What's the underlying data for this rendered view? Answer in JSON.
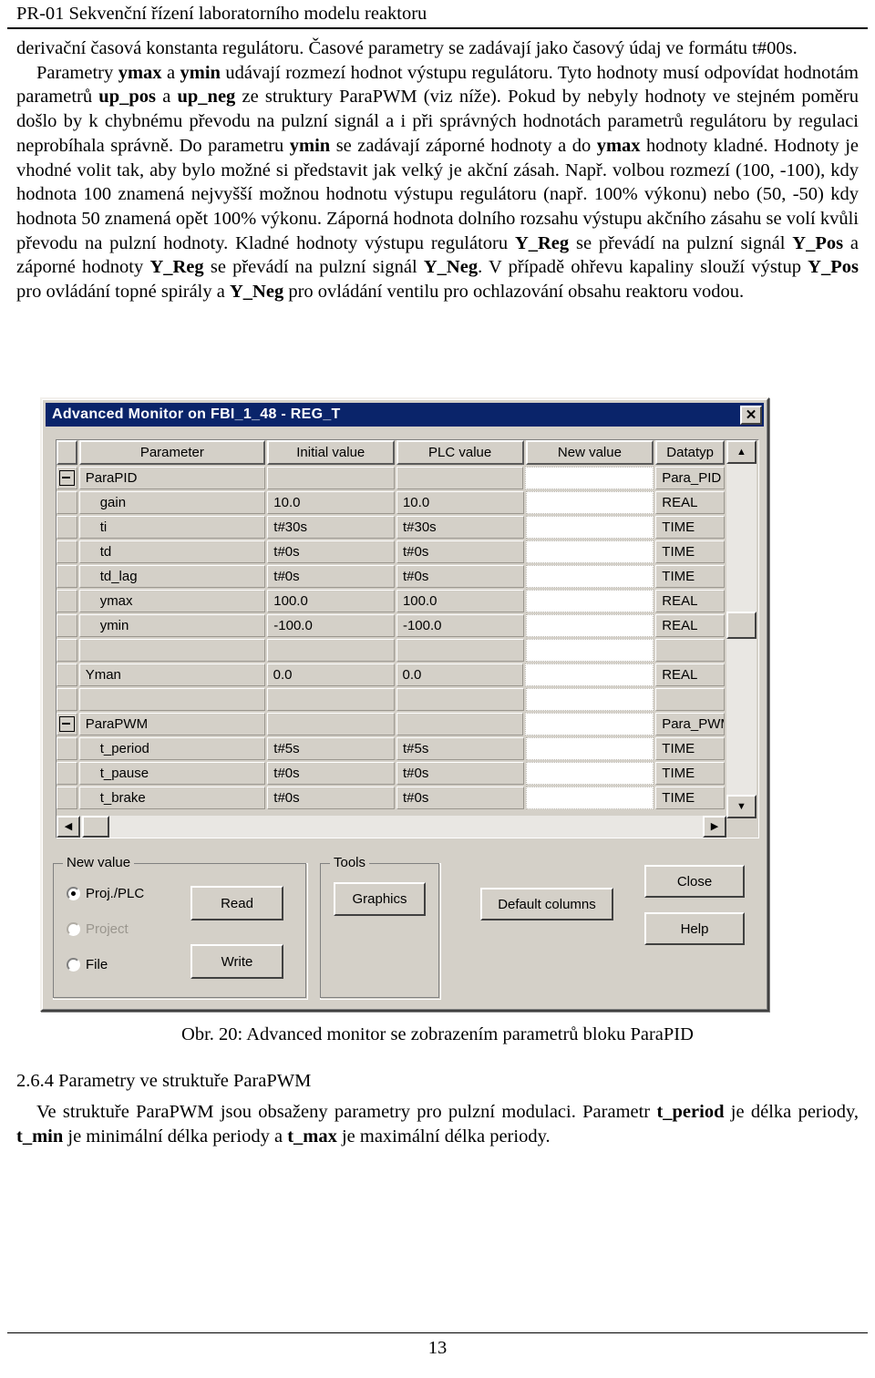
{
  "header": {
    "title": "PR-01 Sekvenční řízení laboratorního modelu reaktoru"
  },
  "body": {
    "para1_a": "derivační časová konstanta regulátoru. Časové parametry se zadávají jako časový údaj ve formátu t#00s.",
    "para2_seg1": "Parametry ",
    "para2_b1": "ymax",
    "para2_seg2": " a ",
    "para2_b2": "ymin",
    "para2_seg3": " udávají rozmezí hodnot výstupu regulátoru. Tyto hodnoty musí odpovídat hodnotám parametrů ",
    "para2_b3": "up_pos",
    "para2_seg4": " a ",
    "para2_b4": "up_neg",
    "para2_seg5": " ze struktury ParaPWM (viz níže). Pokud by nebyly hodnoty ve stejném poměru došlo by k chybnému převodu na pulzní signál a i při správných hodnotách parametrů regulátoru by regulaci neprobíhala správně. Do parametru ",
    "para2_b5": "ymin",
    "para2_seg6": " se zadávají záporné hodnoty a do ",
    "para2_b6": "ymax",
    "para2_seg7": " hodnoty kladné. Hodnoty je vhodné volit tak, aby bylo možné si představit jak velký je akční zásah. Např. volbou rozmezí (100, -100), kdy hodnota 100 znamená nejvyšší možnou hodnotu výstupu regulátoru (např. 100% výkonu) nebo (50, -50) kdy hodnota 50 znamená opět 100% výkonu. Záporná hodnota dolního rozsahu výstupu akčního zásahu se volí kvůli převodu na pulzní hodnoty. Kladné hodnoty výstupu regulátoru ",
    "para2_b7": "Y_Reg",
    "para2_seg8": " se převádí na pulzní signál ",
    "para2_b8": "Y_Pos",
    "para2_seg9": " a záporné hodnoty ",
    "para2_b9": "Y_Reg",
    "para2_seg10": " se převádí na pulzní signál ",
    "para2_b10": "Y_Neg",
    "para2_seg11": ". V případě ohřevu kapaliny slouží výstup ",
    "para2_b11": "Y_Pos",
    "para2_seg12": " pro ovládání topné spirály a ",
    "para2_b12": "Y_Neg",
    "para2_seg13": " pro ovládání ventilu pro ochlazování obsahu reaktoru vodou."
  },
  "dialog": {
    "title": "Advanced Monitor on FBI_1_48  -  REG_T",
    "close_glyph": "✕",
    "columns": [
      "",
      "Parameter",
      "Initial value",
      "PLC value",
      "New value",
      "Datatyp"
    ],
    "rows": [
      {
        "tree": "minus",
        "param": "ParaPID",
        "initial": "",
        "plc": "",
        "new": "",
        "type": "Para_PID",
        "indent": false
      },
      {
        "tree": "",
        "param": "gain",
        "initial": "10.0",
        "plc": "10.0",
        "new": "",
        "type": "REAL",
        "indent": true
      },
      {
        "tree": "",
        "param": "ti",
        "initial": "t#30s",
        "plc": "t#30s",
        "new": "",
        "type": "TIME",
        "indent": true
      },
      {
        "tree": "",
        "param": "td",
        "initial": "t#0s",
        "plc": "t#0s",
        "new": "",
        "type": "TIME",
        "indent": true
      },
      {
        "tree": "",
        "param": "td_lag",
        "initial": "t#0s",
        "plc": "t#0s",
        "new": "",
        "type": "TIME",
        "indent": true
      },
      {
        "tree": "",
        "param": "ymax",
        "initial": "100.0",
        "plc": "100.0",
        "new": "",
        "type": "REAL",
        "indent": true
      },
      {
        "tree": "",
        "param": "ymin",
        "initial": "-100.0",
        "plc": "-100.0",
        "new": "",
        "type": "REAL",
        "indent": true
      },
      {
        "tree": "",
        "param": "",
        "initial": "",
        "plc": "",
        "new": "",
        "type": "",
        "indent": true
      },
      {
        "tree": "",
        "param": "Yman",
        "initial": "0.0",
        "plc": "0.0",
        "new": "",
        "type": "REAL",
        "indent": false
      },
      {
        "tree": "",
        "param": "",
        "initial": "",
        "plc": "",
        "new": "",
        "type": "",
        "indent": true
      },
      {
        "tree": "minus",
        "param": "ParaPWM",
        "initial": "",
        "plc": "",
        "new": "",
        "type": "Para_PWM",
        "indent": false
      },
      {
        "tree": "",
        "param": "t_period",
        "initial": "t#5s",
        "plc": "t#5s",
        "new": "",
        "type": "TIME",
        "indent": true
      },
      {
        "tree": "",
        "param": "t_pause",
        "initial": "t#0s",
        "plc": "t#0s",
        "new": "",
        "type": "TIME",
        "indent": true
      },
      {
        "tree": "",
        "param": "t_brake",
        "initial": "t#0s",
        "plc": "t#0s",
        "new": "",
        "type": "TIME",
        "indent": true
      }
    ],
    "scrollbar": {
      "up_glyph": "▲",
      "down_glyph": "▼",
      "left_glyph": "◀",
      "right_glyph": "▶"
    },
    "new_value_group": {
      "title": "New value",
      "options": [
        {
          "label": "Proj./PLC",
          "checked": true,
          "disabled": false
        },
        {
          "label": "Project",
          "checked": false,
          "disabled": true
        },
        {
          "label": "File",
          "checked": false,
          "disabled": false
        }
      ],
      "read_label": "Read",
      "write_label": "Write"
    },
    "tools_group": {
      "title": "Tools",
      "graphics_label": "Graphics"
    },
    "default_columns_label": "Default columns",
    "close_label": "Close",
    "help_label": "Help"
  },
  "caption": "Obr. 20: Advanced monitor se zobrazením parametrů bloku ParaPID",
  "section": {
    "heading": "2.6.4 Parametry ve struktuře ParaPWM",
    "text_seg1": "Ve struktuře ParaPWM jsou obsaženy parametry pro pulzní modulaci. Parametr ",
    "text_b1": "t_period",
    "text_seg2": " je délka periody, ",
    "text_b2": "t_min",
    "text_seg3": " je minimální délka periody a ",
    "text_b3": "t_max",
    "text_seg4": " je maximální délka periody."
  },
  "footer": {
    "page_number": "13"
  }
}
